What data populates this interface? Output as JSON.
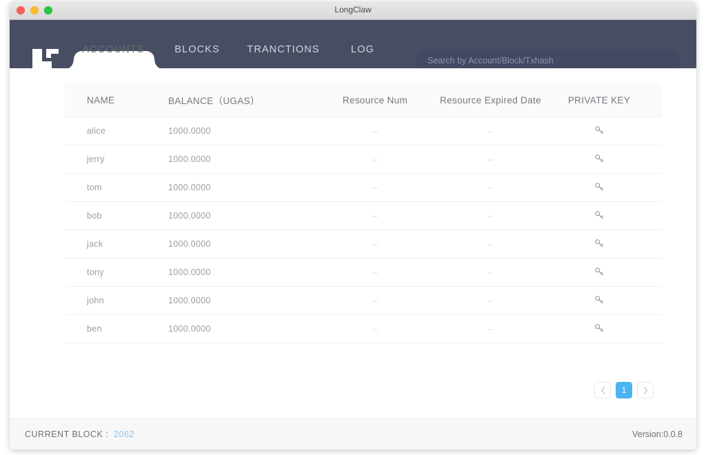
{
  "window": {
    "title": "LongClaw",
    "controls": [
      {
        "name": "close",
        "color": "#ff5f57"
      },
      {
        "name": "minimize",
        "color": "#ffbd2e"
      },
      {
        "name": "maximize",
        "color": "#28c840"
      }
    ]
  },
  "nav": {
    "logo_alt": "LongClaw logo",
    "tabs": [
      {
        "label": "ACCOUNTS",
        "active": true
      },
      {
        "label": "BLOCKS",
        "active": false
      },
      {
        "label": "TRANCTIONS",
        "active": false
      },
      {
        "label": "LOG",
        "active": false
      }
    ],
    "search": {
      "placeholder": "Search by Account/Block/Txhash",
      "value": ""
    }
  },
  "table": {
    "columns": [
      "NAME",
      "BALANCE（UGAS）",
      "Resource Num",
      "Resource Expired Date",
      "PRIVATE KEY"
    ],
    "rows": [
      {
        "name": "alice",
        "balance": "1000.0000",
        "resource_num": "–",
        "resource_expired_date": "–",
        "private_key_icon": "key-icon"
      },
      {
        "name": "jerry",
        "balance": "1000.0000",
        "resource_num": "–",
        "resource_expired_date": "–",
        "private_key_icon": "key-icon"
      },
      {
        "name": "tom",
        "balance": "1000.0000",
        "resource_num": "–",
        "resource_expired_date": "–",
        "private_key_icon": "key-icon"
      },
      {
        "name": "bob",
        "balance": "1000.0000",
        "resource_num": "–",
        "resource_expired_date": "–",
        "private_key_icon": "key-icon"
      },
      {
        "name": "jack",
        "balance": "1000.0000",
        "resource_num": "–",
        "resource_expired_date": "–",
        "private_key_icon": "key-icon"
      },
      {
        "name": "tony",
        "balance": "1000.0000",
        "resource_num": "–",
        "resource_expired_date": "–",
        "private_key_icon": "key-icon"
      },
      {
        "name": "john",
        "balance": "1000.0000",
        "resource_num": "–",
        "resource_expired_date": "–",
        "private_key_icon": "key-icon"
      },
      {
        "name": "ben",
        "balance": "1000.0000",
        "resource_num": "–",
        "resource_expired_date": "–",
        "private_key_icon": "key-icon"
      }
    ]
  },
  "pagination": {
    "prev_icon": "chevron-left-icon",
    "next_icon": "chevron-right-icon",
    "pages": [
      "1"
    ],
    "current_page": "1"
  },
  "footer": {
    "current_block_label": "CURRENT BLOCK :",
    "current_block_value": "2062",
    "version": "Version:0.0.8"
  },
  "colors": {
    "nav_background": "#474e63",
    "search_background": "#434963",
    "accent": "#4db3f2",
    "block_number": "#8fc4e8",
    "content_background": "#ffffff",
    "footer_background": "#f7f7f7"
  }
}
